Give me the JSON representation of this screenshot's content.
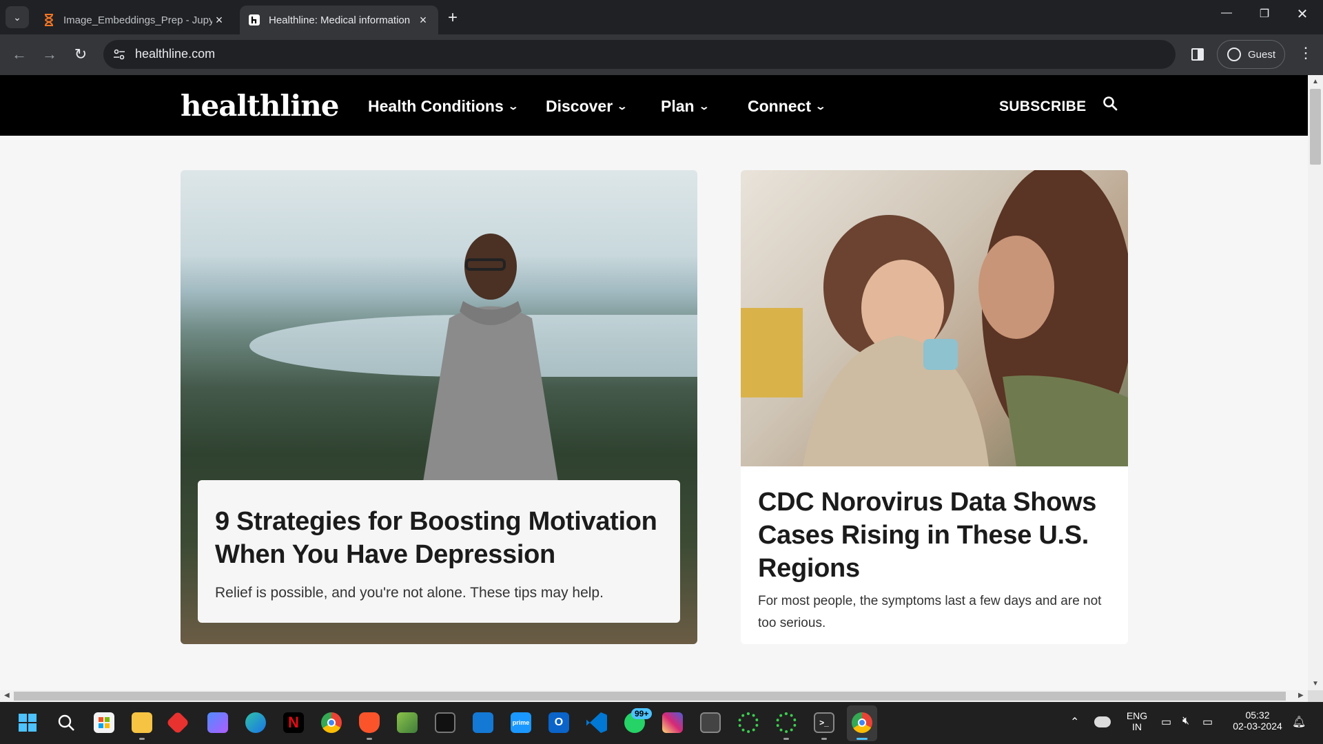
{
  "browser": {
    "tabs": [
      {
        "title": "Image_Embeddings_Prep - Jupyter",
        "active": false,
        "icon": "hourglass-icon"
      },
      {
        "title": "Healthline: Medical information",
        "active": true,
        "icon": "healthline-favicon"
      }
    ],
    "new_tab": "+",
    "url": "healthline.com",
    "profile_label": "Guest"
  },
  "site": {
    "logo": "healthline",
    "menu": [
      {
        "label": "Health Conditions"
      },
      {
        "label": "Discover"
      },
      {
        "label": "Plan"
      },
      {
        "label": "Connect"
      }
    ],
    "subscribe": "SUBSCRIBE"
  },
  "articles": [
    {
      "title": "9 Strategies for Boosting Motivation When You Have Depression",
      "description": "Relief is possible, and you're not alone. These tips may help."
    },
    {
      "title": "CDC Norovirus Data Shows Cases Rising in These U.S. Regions",
      "description": "For most people, the symptoms last a few days and are not too serious."
    }
  ],
  "taskbar": {
    "apps": [
      "start",
      "search",
      "store",
      "files",
      "app-red",
      "copilot",
      "edge",
      "netflix",
      "chrome",
      "brave",
      "photos",
      "terminal-dark",
      "windows-app",
      "prime-video",
      "outlook",
      "vscode",
      "whatsapp",
      "instagram",
      "terminal-gray",
      "circle-green-1",
      "circle-green-2",
      "cmd",
      "chrome-active"
    ],
    "whatsapp_badge": "99+",
    "language_line1": "ENG",
    "language_line2": "IN",
    "time": "05:32",
    "date": "02-03-2024"
  },
  "colors": {
    "nav_bg": "#000000",
    "page_bg": "#f6f6f6",
    "chrome_bg": "#202124",
    "toolbar_bg": "#35363a"
  }
}
